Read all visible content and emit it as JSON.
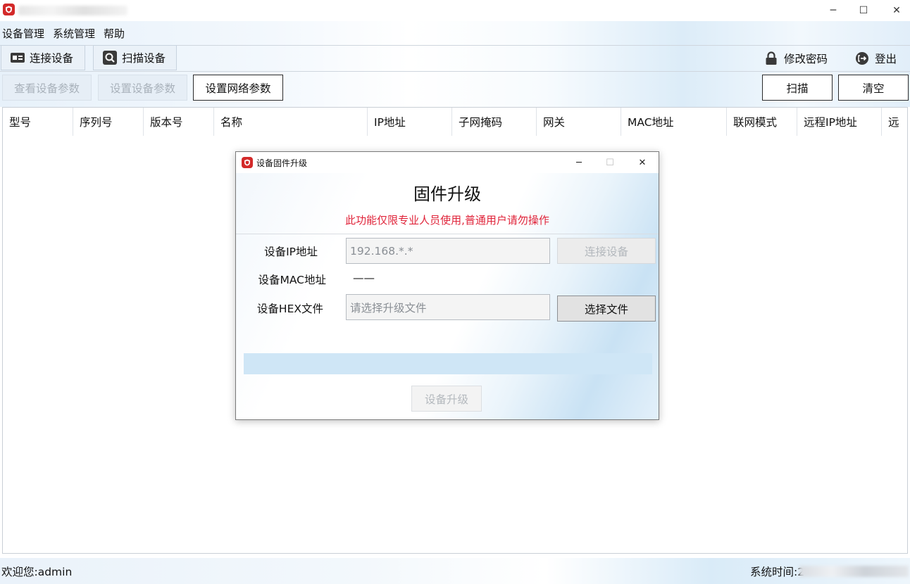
{
  "window": {
    "minimize_glyph": "─",
    "maximize_glyph": "☐",
    "close_glyph": "✕"
  },
  "menu": [
    "设备管理",
    "系统管理",
    "帮助"
  ],
  "toolbar": {
    "connect_device": "连接设备",
    "scan_device": "扫描设备",
    "change_password": "修改密码",
    "logout": "登出"
  },
  "actions": {
    "view_params": "查看设备参数",
    "set_params": "设置设备参数",
    "set_network_params": "设置网络参数",
    "scan": "扫描",
    "clear": "清空"
  },
  "table": {
    "columns": [
      "型号",
      "序列号",
      "版本号",
      "名称",
      "IP地址",
      "子网掩码",
      "网关",
      "MAC地址",
      "联网模式",
      "远程IP地址",
      "远"
    ],
    "rows": []
  },
  "status": {
    "welcome": "欢迎您:admin",
    "system_time_label": "系统时间:2"
  },
  "dialog": {
    "title": "设备固件升级",
    "heading": "固件升级",
    "warning": "此功能仅限专业人员使用,普通用户请勿操作",
    "ip_label": "设备IP地址",
    "ip_value": "192.168.*.*",
    "connect_button": "连接设备",
    "mac_label": "设备MAC地址",
    "mac_value": "——",
    "hex_label": "设备HEX文件",
    "hex_placeholder": "请选择升级文件",
    "choose_file_button": "选择文件",
    "progress": 0,
    "upgrade_button": "设备升级",
    "minimize_glyph": "─",
    "maximize_glyph": "☐",
    "close_glyph": "✕"
  },
  "colors": {
    "brand_red": "#d32a2a",
    "warning_red": "#e0243a",
    "progress_track": "#cfe6f6"
  }
}
